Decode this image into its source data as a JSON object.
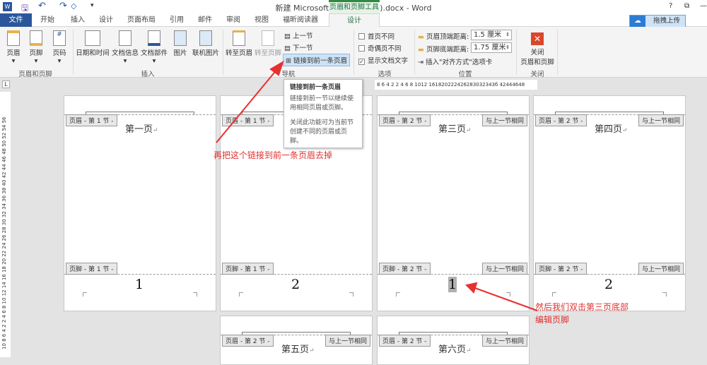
{
  "window": {
    "title": "新建 Microsoft Word 文档 (5).docx - Word",
    "help": "?",
    "restore": "⧉",
    "minimize": "—"
  },
  "contextual_tab": "页眉和页脚工具",
  "tabs": [
    "文件",
    "开始",
    "插入",
    "设计",
    "页面布局",
    "引用",
    "邮件",
    "审阅",
    "视图",
    "福昕阅读器",
    "设计"
  ],
  "upload_button": "拖拽上传",
  "ribbon": {
    "header_footer": {
      "buttons": [
        "页眉",
        "页脚",
        "页码"
      ],
      "group": "页眉和页脚"
    },
    "insert": {
      "buttons": [
        "日期和时间",
        "文档信息",
        "文档部件",
        "图片",
        "联机图片"
      ],
      "group": "插入"
    },
    "navigation": {
      "goto_header": "转至页眉",
      "goto_footer": "转至页脚",
      "prev": "上一节",
      "next": "下一节",
      "link": "链接到前一条页眉",
      "group": "导航"
    },
    "options": {
      "items": [
        {
          "label": "首页不同",
          "checked": false
        },
        {
          "label": "奇偶页不同",
          "checked": false
        },
        {
          "label": "显示文档文字",
          "checked": true
        }
      ],
      "group": "选项"
    },
    "position": {
      "header_label": "页眉顶端距离:",
      "header_value": "1.5 厘米",
      "footer_label": "页脚底端距离:",
      "footer_value": "1.75 厘米",
      "insert_tab": "插入\"对齐方式\"选项卡",
      "group": "位置"
    },
    "close": {
      "label1": "关闭",
      "label2": "页眉和页脚",
      "group": "关闭"
    }
  },
  "tooltip": {
    "title": "链接到前一条页眉",
    "line1": "链接到前一节以继续使用相同页眉或页脚。",
    "line2": "关闭此功能可为当前节创建不同的页眉或页脚。"
  },
  "ruler_top": "8 6 4 2   2 4 6 8 1012   161820222426283032343б   42444648",
  "ruler_left": "10 8 6 4 2   2 4 6 8 10 12 14 16 18 20 22 24 26 28 30 32 34 36 38 40 42 44 46 48 50 52 54 56",
  "pages": [
    {
      "header": "页眉 - 第 1 节 -",
      "title": "第一页",
      "same": "",
      "footer": "页脚 - 第 1 节 -",
      "fsame": "",
      "num": "1"
    },
    {
      "header": "页眉 - 第 1 节 -",
      "title": "",
      "same": "",
      "footer": "页脚 - 第 1 节 -",
      "fsame": "",
      "num": "2"
    },
    {
      "header": "页眉 - 第 2 节 -",
      "title": "第三页",
      "same": "与上一节相同",
      "footer": "页脚 - 第 2 节 -",
      "fsame": "与上一节相同",
      "num": "1"
    },
    {
      "header": "页眉 - 第 2 节 -",
      "title": "第四页",
      "same": "与上一节相同",
      "footer": "页脚 - 第 2 节 -",
      "fsame": "与上一节相同",
      "num": "2"
    },
    {
      "header": "页眉 - 第 2 节 -",
      "title": "第五页",
      "same": "与上一节相同"
    },
    {
      "header": "页眉 - 第 2 节 -",
      "title": "第六页",
      "same": "与上一节相同"
    }
  ],
  "annotations": {
    "a1": "再把这个链接到前一条页眉去掉",
    "a2_line1": "然后我们双击第三页底部",
    "a2_line2": "编辑页脚"
  },
  "colors": {
    "accent": "#2b579a",
    "annotation": "#e03030",
    "context": "#217346"
  }
}
